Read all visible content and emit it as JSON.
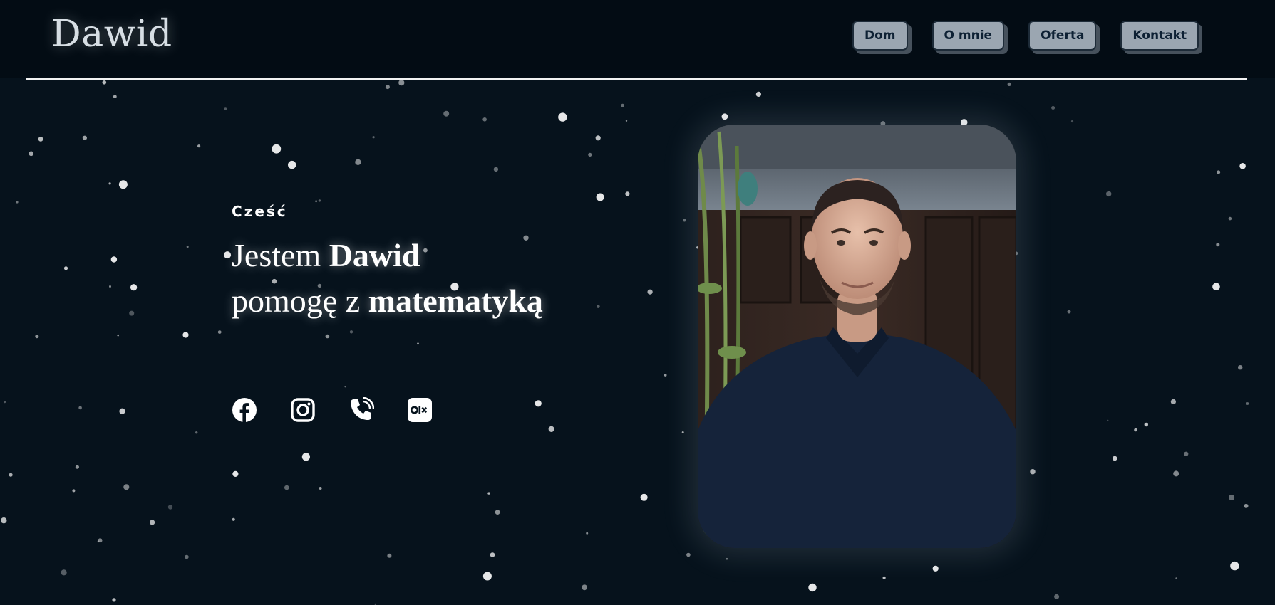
{
  "header": {
    "logo": "Dawid",
    "nav": [
      {
        "label": "Dom"
      },
      {
        "label": "O mnie"
      },
      {
        "label": "Oferta"
      },
      {
        "label": "Kontakt"
      }
    ]
  },
  "hero": {
    "greeting": "Cześć",
    "line1_prefix": "Jestem ",
    "line1_name": "Dawid",
    "line2_prefix": "pomogę z ",
    "line2_subject": "matematyką"
  },
  "socials": [
    {
      "icon": "facebook-icon"
    },
    {
      "icon": "instagram-icon"
    },
    {
      "icon": "phone-icon"
    },
    {
      "icon": "olx-icon"
    }
  ],
  "colors": {
    "background": "#06121c",
    "header": "#030c14",
    "nav_button": "#9ba6b1",
    "nav_text": "#0e2134",
    "accent_line": "#f2f2f2"
  }
}
